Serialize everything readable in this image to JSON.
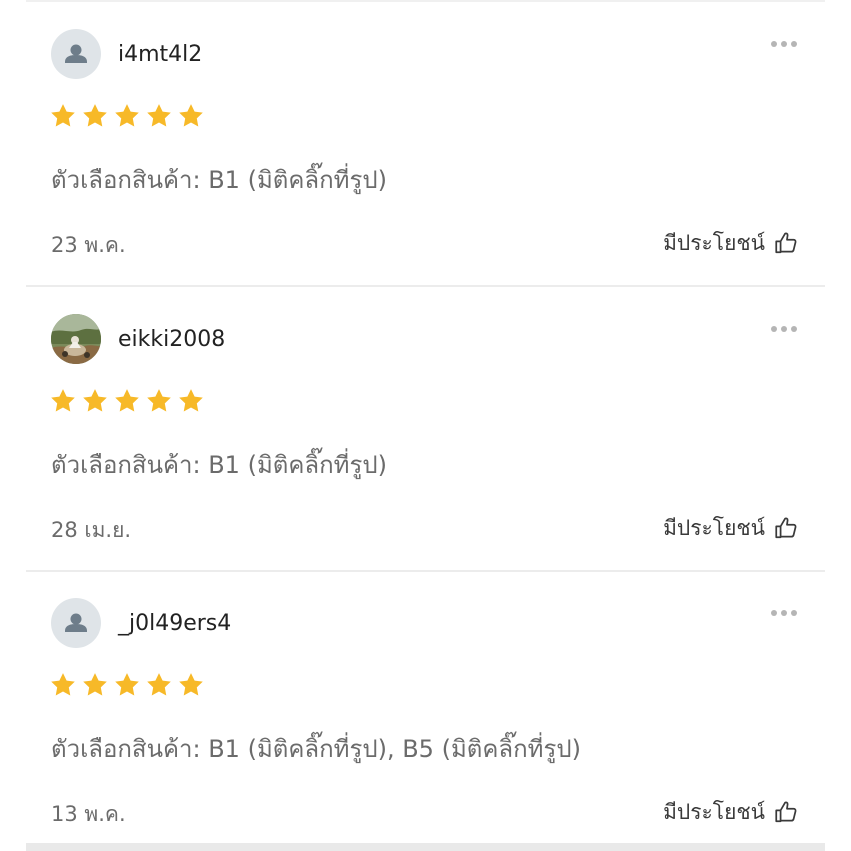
{
  "theme": {
    "star_color": "#f7b928",
    "text_muted": "#6b6b6b",
    "avatar_bg": "#dfe4e8",
    "avatar_person": "#6e7d8a"
  },
  "reviews": [
    {
      "username": "i4mt4l2",
      "avatar_icon": "default-user-avatar",
      "rating": 5,
      "variation": "ตัวเลือกสินค้า: B1 (มิติคลิ๊กที่รูป)",
      "date": "23 พ.ค.",
      "helpful_label": "มีประโยชน์"
    },
    {
      "username": "eikki2008",
      "avatar_icon": "photo-avatar",
      "rating": 5,
      "variation": "ตัวเลือกสินค้า: B1 (มิติคลิ๊กที่รูป)",
      "date": "28 เม.ย.",
      "helpful_label": "มีประโยชน์"
    },
    {
      "username": "_j0l49ers4",
      "avatar_icon": "default-user-avatar",
      "rating": 5,
      "variation": "ตัวเลือกสินค้า: B1 (มิติคลิ๊กที่รูป), B5 (มิติคลิ๊กที่รูป)",
      "date": "13 พ.ค.",
      "helpful_label": "มีประโยชน์"
    }
  ]
}
